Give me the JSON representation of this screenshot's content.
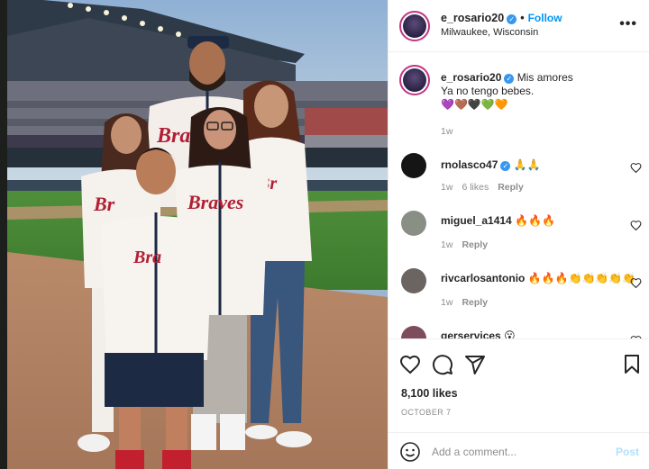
{
  "post": {
    "author": "e_rosario20",
    "follow_label": "Follow",
    "location": "Milwaukee, Wisconsin",
    "more_label": "•••",
    "caption_line1": "Mis amores",
    "caption_line2": "Ya no tengo bebes.",
    "caption_hearts": "💜🤎🖤💚🧡",
    "caption_time": "1w",
    "likes": "8,100 likes",
    "date": "OCTOBER 7"
  },
  "comments": [
    {
      "user": "rnolasco47",
      "verified": true,
      "text": "🙏🙏",
      "time": "1w",
      "likes": "6 likes",
      "reply": "Reply"
    },
    {
      "user": "miguel_a1414",
      "verified": false,
      "text": "🔥🔥🔥",
      "time": "1w",
      "likes": "",
      "reply": "Reply"
    },
    {
      "user": "rivcarlosantonio",
      "verified": false,
      "text": "🔥🔥🔥👏👏👏👏👏",
      "time": "1w",
      "likes": "",
      "reply": "Reply"
    },
    {
      "user": "gerservices",
      "verified": false,
      "text": "😮",
      "time": "",
      "likes": "",
      "reply": ""
    }
  ],
  "add_comment": {
    "placeholder": "Add a comment...",
    "post_label": "Post"
  },
  "icons": {
    "like": "heart-icon",
    "comment": "comment-bubble-icon",
    "share": "paper-plane-icon",
    "save": "bookmark-icon",
    "emoji": "smiley-icon",
    "more": "ellipsis-icon"
  },
  "colors": {
    "link_blue": "#0095f6",
    "verified_blue": "#3897f0",
    "muted": "#8e8e8e",
    "post_disabled": "#b2dffc"
  }
}
